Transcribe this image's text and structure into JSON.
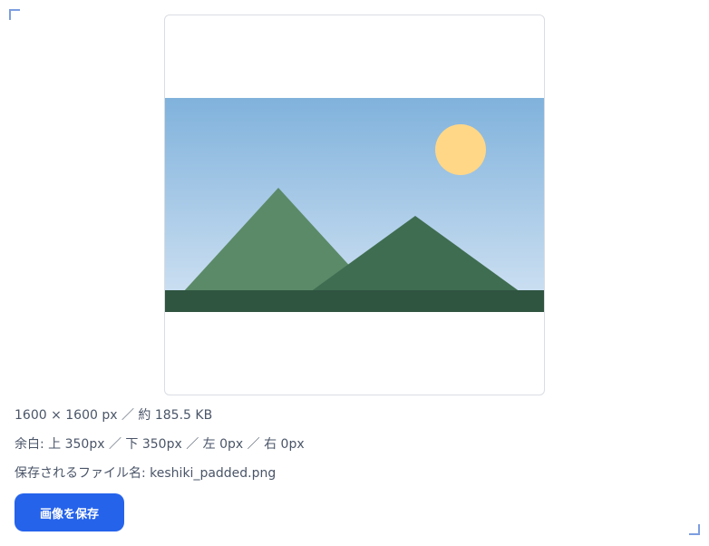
{
  "image_preview": {
    "alt": "mountain landscape with sun",
    "colors": {
      "sky_top": "#80b2dc",
      "sky_bottom": "#d2e3f3",
      "sun": "#ffd787",
      "mountain_left": "#5b8a68",
      "mountain_right": "#3f6d51",
      "ground": "#2f5440",
      "padding": "#ffffff"
    }
  },
  "info": {
    "size_line": "1600 × 1600 px ／ 約 185.5 KB",
    "margin_line": "余白: 上 350px ／ 下 350px ／ 左 0px ／ 右 0px",
    "file_line": "保存されるファイル名: keshiki_padded.png"
  },
  "actions": {
    "save_label": "画像を保存"
  },
  "accent_color": "#2563eb"
}
